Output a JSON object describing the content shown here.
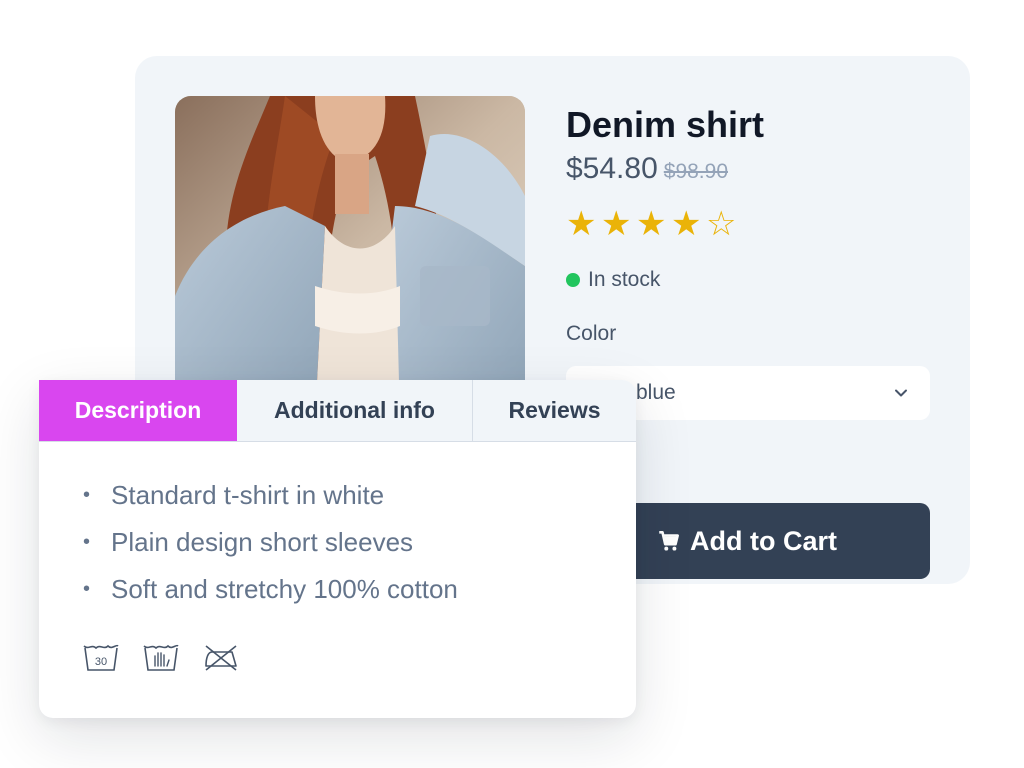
{
  "product": {
    "title": "Denim shirt",
    "price": "$54.80",
    "old_price": "$98.90",
    "rating": {
      "value": 4,
      "max": 5
    },
    "stock_status": "In stock",
    "color_label": "Color",
    "color_value": "blue",
    "cart_button": "Add to Cart"
  },
  "tabs": [
    {
      "label": "Description",
      "active": true
    },
    {
      "label": "Additional info",
      "active": false
    },
    {
      "label": "Reviews",
      "active": false
    }
  ],
  "description": {
    "features": [
      "Standard t-shirt in white",
      "Plain design short sleeves",
      "Soft and stretchy 100% cotton"
    ],
    "care_icons": [
      {
        "icon": "wash-30-icon",
        "text": "30"
      },
      {
        "icon": "hand-wash-icon"
      },
      {
        "icon": "do-not-iron-icon"
      }
    ]
  },
  "colors": {
    "accent": "#d946ef",
    "button": "#334155",
    "star": "#eab308",
    "in_stock": "#22c55e",
    "card_bg": "#f1f5f9"
  }
}
